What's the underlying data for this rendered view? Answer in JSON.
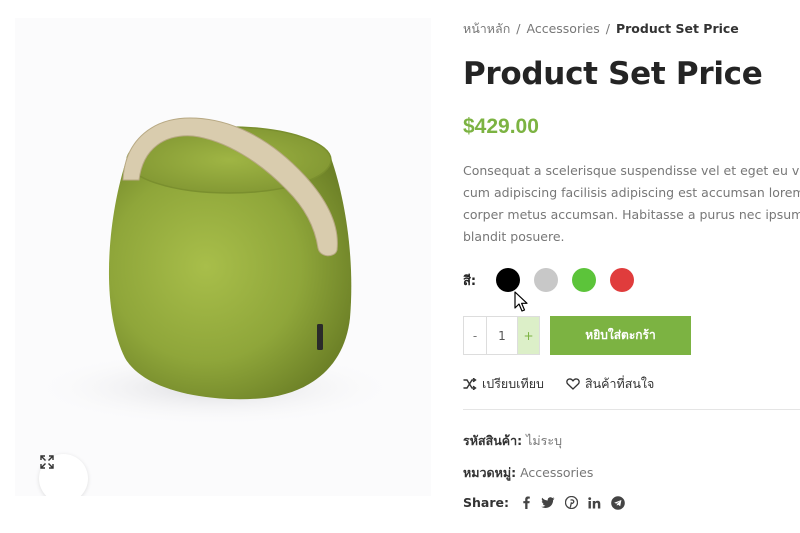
{
  "breadcrumb": {
    "home": "หน้าหลัก",
    "category": "Accessories",
    "current": "Product Set Price"
  },
  "product": {
    "title": "Product Set Price",
    "price": "$429.00",
    "description_lines": [
      "Consequat a scelerisque suspendisse vel et eget eu vitae a",
      "cum adipiscing facilisis adipiscing est accumsan lorem vest",
      "corper metus accumsan. Habitasse a purus nec ipsum a urn",
      "blandit posuere."
    ]
  },
  "colors": {
    "label": "สี:",
    "swatches": [
      {
        "name": "black",
        "hex": "#000000"
      },
      {
        "name": "silver",
        "hex": "#c8c8c8"
      },
      {
        "name": "green",
        "hex": "#5cc43a"
      },
      {
        "name": "red",
        "hex": "#e03c3c"
      }
    ]
  },
  "cart": {
    "minus": "-",
    "quantity": "1",
    "plus": "+",
    "add_to_cart": "หยิบใส่ตะกร้า"
  },
  "actions": {
    "compare": "เปรียบเทียบ",
    "wishlist": "สินค้าที่สนใจ"
  },
  "meta": {
    "sku_label": "รหัสสินค้า:",
    "sku_value": "ไม่ระบุ",
    "category_label": "หมวดหมู่:",
    "category_value": "Accessories"
  },
  "share": {
    "label": "Share:",
    "icons": [
      "facebook-icon",
      "twitter-icon",
      "pinterest-icon",
      "linkedin-icon",
      "telegram-icon"
    ]
  },
  "theme": {
    "accent": "#7cb342",
    "product_color": "#8fa83a"
  }
}
